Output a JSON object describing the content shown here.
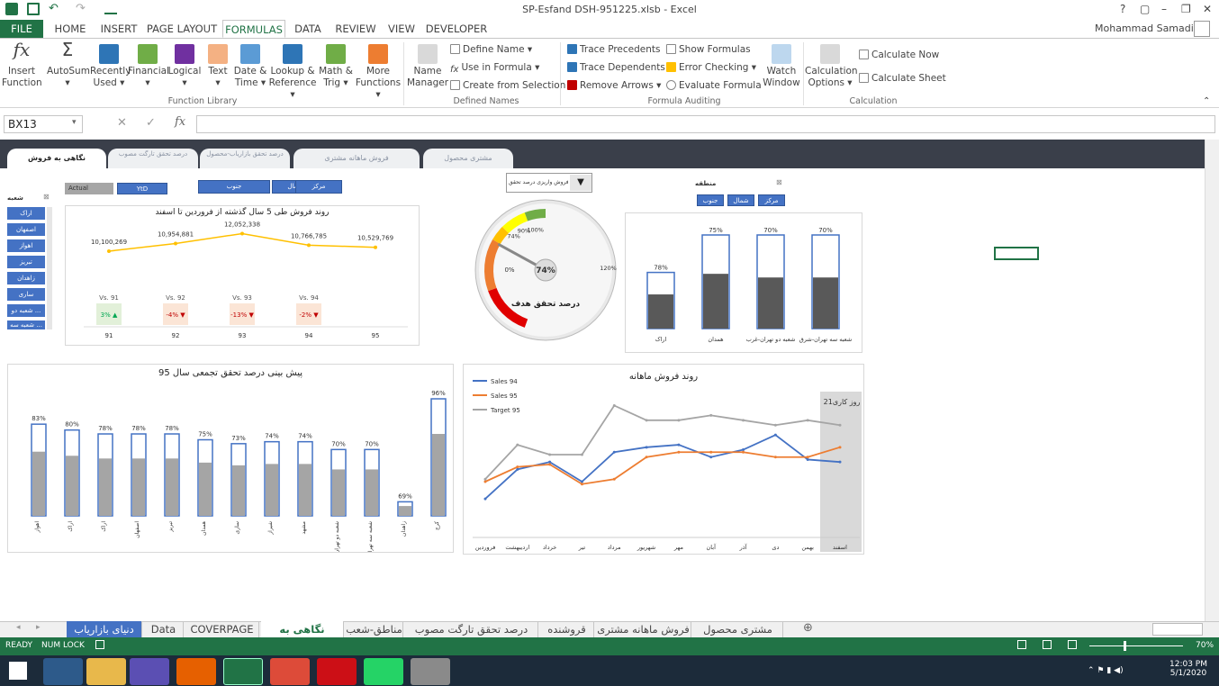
{
  "window": {
    "title": "SP-Esfand DSH-951225.xlsb - Excel",
    "user": "Mohammad Samadi",
    "controls": [
      "?",
      "▢",
      "–",
      "❐",
      "✕"
    ]
  },
  "ribbon_tabs": [
    "FILE",
    "HOME",
    "INSERT",
    "PAGE LAYOUT",
    "FORMULAS",
    "DATA",
    "REVIEW",
    "VIEW",
    "DEVELOPER"
  ],
  "ribbon": {
    "function_library": {
      "label": "Function Library",
      "buttons": [
        {
          "l1": "Insert",
          "l2": "Function"
        },
        {
          "l1": "AutoSum",
          "l2": "▾"
        },
        {
          "l1": "Recently",
          "l2": "Used ▾"
        },
        {
          "l1": "Financial",
          "l2": "▾"
        },
        {
          "l1": "Logical",
          "l2": "▾"
        },
        {
          "l1": "Text",
          "l2": "▾"
        },
        {
          "l1": "Date &",
          "l2": "Time ▾"
        },
        {
          "l1": "Lookup &",
          "l2": "Reference ▾"
        },
        {
          "l1": "Math &",
          "l2": "Trig ▾"
        },
        {
          "l1": "More",
          "l2": "Functions ▾"
        }
      ]
    },
    "defined_names": {
      "label": "Defined Names",
      "name_manager_1": "Name",
      "name_manager_2": "Manager",
      "items": [
        "Define Name ▾",
        "Use in Formula ▾",
        "Create from Selection"
      ]
    },
    "formula_auditing": {
      "label": "Formula Auditing",
      "left": [
        "Trace Precedents",
        "Trace Dependents",
        "Remove Arrows ▾"
      ],
      "right": [
        "Show Formulas",
        "Error Checking ▾",
        "Evaluate Formula"
      ],
      "watch_1": "Watch",
      "watch_2": "Window"
    },
    "calculation": {
      "label": "Calculation",
      "opt_1": "Calculation",
      "opt_2": "Options ▾",
      "items": [
        "Calculate Now",
        "Calculate Sheet"
      ]
    }
  },
  "formula_bar": {
    "name_box": "BX13",
    "formula": ""
  },
  "dashboard": {
    "nav_tabs": [
      "نگاهی به فروش",
      "درصد تحقق تارگت مصوب",
      "درصد تحقق بازاریاب-محصول",
      "فروش ماهانه مشتری",
      "مشتری محصول"
    ],
    "toggle": [
      "Actual",
      "YtD"
    ],
    "regions": [
      "جنوب",
      "شمال",
      "مرکز"
    ],
    "branch_slicer": {
      "title": "شعبه",
      "items": [
        "اراک",
        "اصفهان",
        "اهواز",
        "تبریز",
        "زاهدان",
        "ساری",
        "شعبه دو ...",
        "شعبه سه ..."
      ]
    },
    "dropdown_label": "فروش واریزی درصد تحقق",
    "region_slicer_title": "منطقه",
    "colors": {
      "accent": "#217346",
      "blue": "#4472c4",
      "orange": "#ed7d31",
      "gray": "#a5a5a5",
      "nav": "#3a3f4a"
    }
  },
  "chart_data": [
    {
      "type": "line",
      "title": "روند فروش طی 5 سال گذشته از فروردین تا اسفند",
      "categories": [
        "91",
        "92",
        "93",
        "94",
        "95"
      ],
      "values": [
        10100269,
        10954881,
        12052338,
        10766785,
        10529769
      ],
      "value_labels": [
        "10,100,269",
        "10,954,881",
        "12,052,338",
        "10,766,785",
        "10,529,769"
      ],
      "vs_labels": [
        "Vs. 91",
        "Vs. 92",
        "Vs. 93",
        "Vs. 94"
      ],
      "vs_changes": [
        "3% ▲",
        "-4% ▼",
        "-13% ▼",
        "-2% ▼"
      ]
    },
    {
      "type": "gauge",
      "title": "درصد تحقق هدف",
      "value": 74,
      "value_label": "74%",
      "min_label": "0%",
      "tick_labels": [
        "74%",
        "90%",
        "100%",
        "120%"
      ]
    },
    {
      "type": "bar",
      "categories": [
        "اراک",
        "همدان",
        "شعبه دو تهران-غرب",
        "شعبه سه تهران-شرق"
      ],
      "values": [
        78,
        75,
        70,
        70
      ],
      "value_labels": [
        "78%",
        "75%",
        "70%",
        "70%"
      ],
      "series": [
        {
          "values": [
            78,
            75,
            70,
            70
          ]
        },
        {
          "values": [
            100,
            100,
            100,
            100
          ]
        }
      ]
    },
    {
      "type": "bar",
      "title": "پیش بینی درصد تحقق تجمعی سال 95",
      "categories": [
        "اهواز",
        "اراک",
        "اراک",
        "اصفهان",
        "تبریز",
        "همدان",
        "ساری",
        "شیراز",
        "مشهد",
        "شعبه دو تهران-غرب",
        "شعبه سه تهران-شرق",
        "زاهدان",
        "کرج"
      ],
      "value_labels": [
        "83%",
        "80%",
        "78%",
        "78%",
        "78%",
        "75%",
        "73%",
        "74%",
        "74%",
        "70%",
        "70%",
        "69%",
        "96%"
      ],
      "series": [
        {
          "values": [
            83,
            80,
            78,
            78,
            78,
            75,
            73,
            74,
            74,
            70,
            70,
            69,
            96
          ]
        },
        {
          "values": [
            100,
            100,
            100,
            100,
            100,
            100,
            100,
            100,
            100,
            100,
            100,
            100,
            100
          ]
        }
      ]
    },
    {
      "type": "line",
      "title": "روند فروش ماهانه",
      "categories": [
        "فروردین",
        "اردیبهشت",
        "خرداد",
        "تیر",
        "مرداد",
        "شهریور",
        "مهر",
        "آبان",
        "آذر",
        "دی",
        "بهمن",
        "اسفند"
      ],
      "annotation": "21روز کاری",
      "series": [
        {
          "name": "Sales 94",
          "values": [
            1.0,
            1.6,
            1.75,
            1.35,
            1.95,
            2.05,
            2.1,
            1.85,
            2.0,
            2.3,
            1.8,
            1.75
          ]
        },
        {
          "name": "Sales 95",
          "values": [
            1.35,
            1.65,
            1.7,
            1.3,
            1.4,
            1.85,
            1.95,
            1.95,
            1.95,
            1.85,
            1.85,
            2.05
          ]
        },
        {
          "name": "Target 95",
          "values": [
            1.4,
            2.1,
            1.9,
            1.9,
            2.9,
            2.6,
            2.6,
            2.7,
            2.6,
            2.5,
            2.6,
            2.5
          ]
        }
      ]
    }
  ],
  "sheet_tabs": [
    "دنیای بازاریاب",
    "Data",
    "COVERPAGE",
    "نگاهی به فروش",
    "مناطق-شعب",
    "درصد تحقق تارگت مصوب",
    "قروشنده",
    "فروش ماهانه مشتری",
    "مشتری محصول"
  ],
  "status": {
    "ready": "READY",
    "numlock": "NUM LOCK",
    "zoom": "70%"
  },
  "taskbar": {
    "time": "12:03 PM",
    "date": "5/1/2020"
  }
}
